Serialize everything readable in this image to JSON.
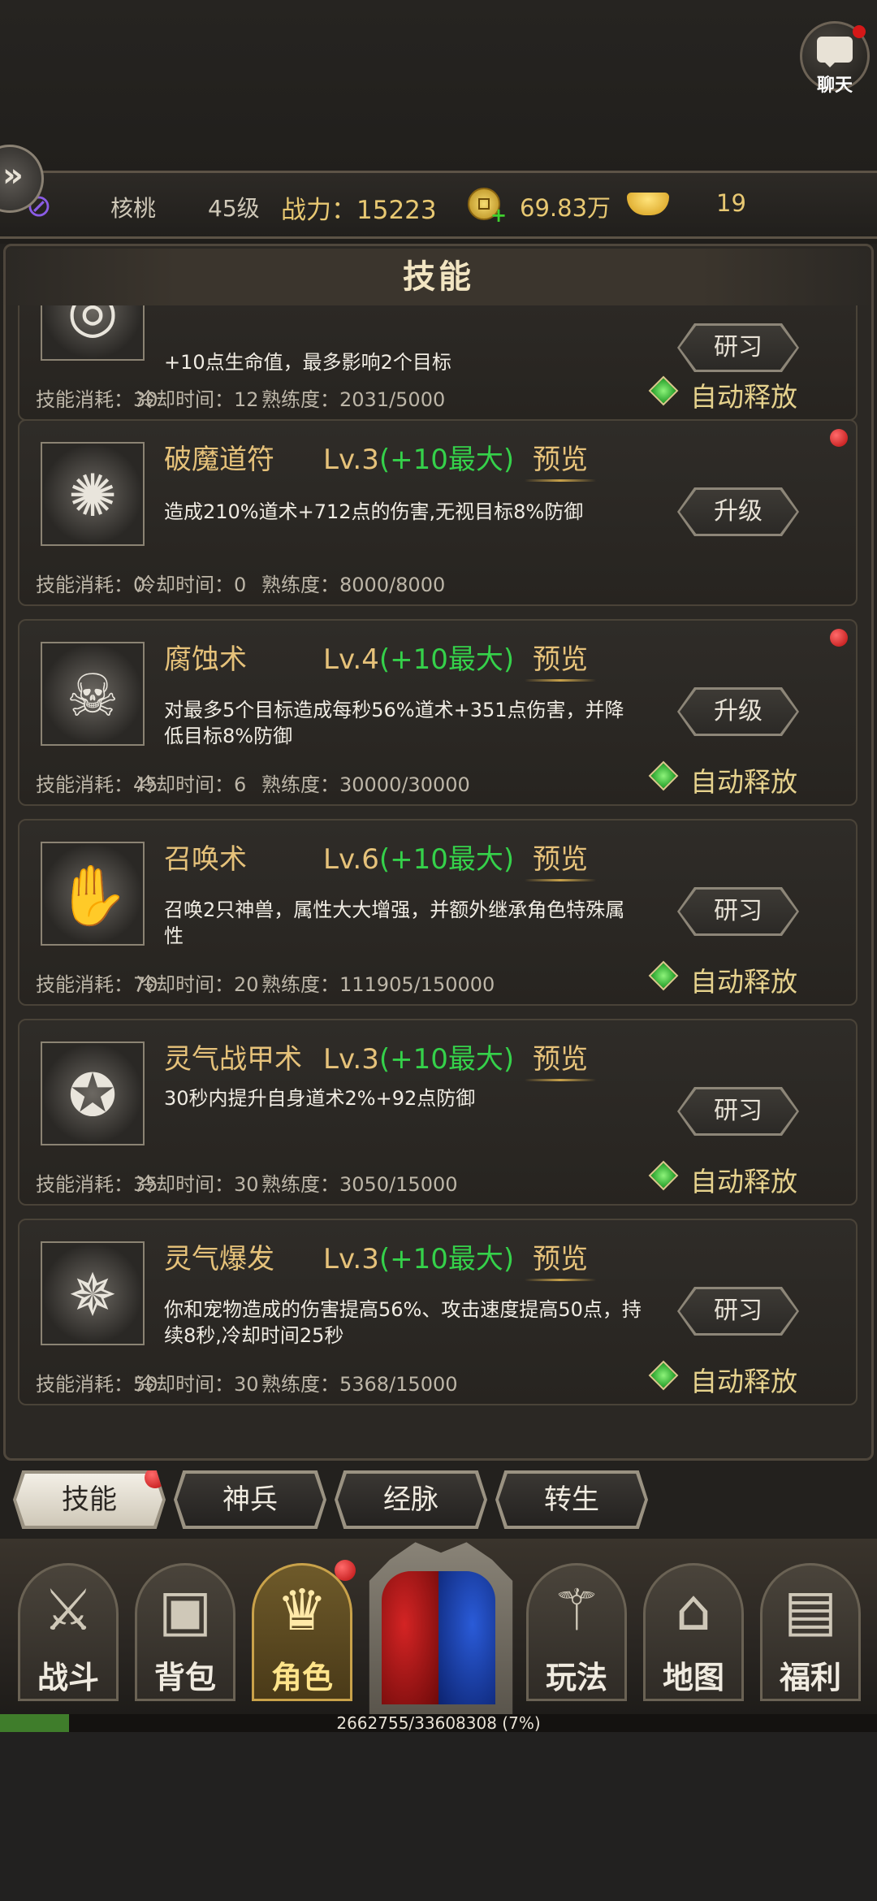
{
  "chat": {
    "label": "聊天"
  },
  "status": {
    "name": "核桃",
    "level": "45级",
    "power": "战力：15223",
    "gold": "69.83万",
    "yuanbao": "19"
  },
  "panel": {
    "title": "技能"
  },
  "skills": [
    {
      "name": "",
      "level": "",
      "level_bonus": "",
      "preview": "",
      "desc": "+10点生命值，最多影响2个目标",
      "button": "研习",
      "cost": "技能消耗：30",
      "cooldown": "冷却时间：12",
      "proficiency": "熟练度：2031/5000",
      "auto": "自动释放",
      "has_auto": true,
      "has_dot": false
    },
    {
      "name": "破魔道符",
      "level": "Lv.3",
      "level_bonus": "(+10最大)",
      "preview": "预览",
      "desc": "造成210%道术+712点的伤害,无视目标8%防御",
      "button": "升级",
      "cost": "技能消耗：0",
      "cooldown": "冷却时间：0",
      "proficiency": "熟练度：8000/8000",
      "auto": "",
      "has_auto": false,
      "has_dot": true
    },
    {
      "name": "腐蚀术",
      "level": "Lv.4",
      "level_bonus": "(+10最大)",
      "preview": "预览",
      "desc": "对最多5个目标造成每秒56%道术+351点伤害，并降低目标8%防御",
      "button": "升级",
      "cost": "技能消耗：45",
      "cooldown": "冷却时间：6",
      "proficiency": "熟练度：30000/30000",
      "auto": "自动释放",
      "has_auto": true,
      "has_dot": true
    },
    {
      "name": "召唤术",
      "level": "Lv.6",
      "level_bonus": "(+10最大)",
      "preview": "预览",
      "desc": "召唤2只神兽，属性大大增强，并额外继承角色特殊属性",
      "button": "研习",
      "cost": "技能消耗：70",
      "cooldown": "冷却时间：20",
      "proficiency": "熟练度：111905/150000",
      "auto": "自动释放",
      "has_auto": true,
      "has_dot": false
    },
    {
      "name": "灵气战甲术",
      "level": "Lv.3",
      "level_bonus": "(+10最大)",
      "preview": "预览",
      "desc": "30秒内提升自身道术2%+92点防御",
      "button": "研习",
      "cost": "技能消耗：35",
      "cooldown": "冷却时间：30",
      "proficiency": "熟练度：3050/15000",
      "auto": "自动释放",
      "has_auto": true,
      "has_dot": false
    },
    {
      "name": "灵气爆发",
      "level": "Lv.3",
      "level_bonus": "(+10最大)",
      "preview": "预览",
      "desc": "你和宠物造成的伤害提高56%、攻击速度提高50点，持续8秒,冷却时间25秒",
      "button": "研习",
      "cost": "技能消耗：50",
      "cooldown": "冷却时间：30",
      "proficiency": "熟练度：5368/15000",
      "auto": "自动释放",
      "has_auto": true,
      "has_dot": false
    }
  ],
  "tabs": [
    {
      "label": "技能",
      "active": true,
      "dot": true
    },
    {
      "label": "神兵",
      "active": false,
      "dot": false
    },
    {
      "label": "经脉",
      "active": false,
      "dot": false
    },
    {
      "label": "转生",
      "active": false,
      "dot": false
    }
  ],
  "nav": [
    {
      "label": "战斗",
      "icon": "crossed-swords-icon"
    },
    {
      "label": "背包",
      "icon": "backpack-icon"
    },
    {
      "label": "角色",
      "icon": "crown-helmet-icon",
      "active": true,
      "dot": true
    },
    {
      "label": "玩法",
      "icon": "blade-icon"
    },
    {
      "label": "地图",
      "icon": "map-icon"
    },
    {
      "label": "福利",
      "icon": "treasure-chest-icon"
    }
  ],
  "exp": {
    "text": "2662755/33608308 (7%)",
    "fraction": 0.079
  }
}
